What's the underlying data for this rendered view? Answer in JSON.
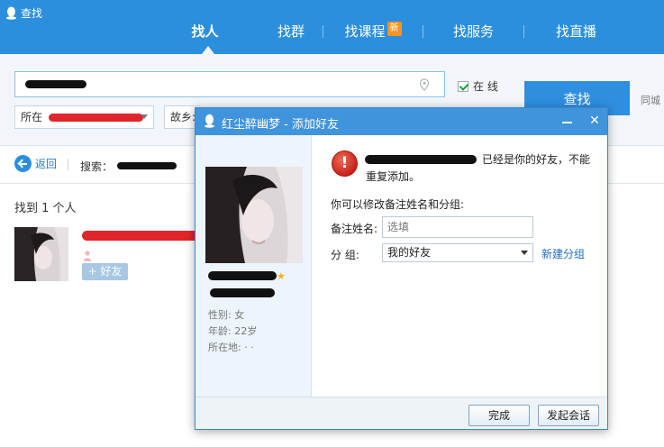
{
  "app": {
    "title": "查找"
  },
  "tabs": [
    {
      "label": "找人"
    },
    {
      "label": "找群"
    },
    {
      "label": "找课程"
    },
    {
      "label": "找服务"
    },
    {
      "label": "找直播"
    }
  ],
  "new_badge": "新",
  "search": {
    "online_label": "在  线",
    "button": "查找",
    "same_city": "同城",
    "filter_location": "所在",
    "filter_hometown": "故乡:"
  },
  "results": {
    "back": "返回",
    "search_label": "搜索：",
    "found": "找到 1 个人",
    "add_friend": "+ 好友"
  },
  "dialog": {
    "title": "红尘醉幽梦 - 添加好友",
    "message_line1": "已经是你的好友，不能",
    "message_line2": "重复添加。",
    "can_modify": "你可以修改备注姓名和分组:",
    "remark_label": "备注姓名:",
    "remark_placeholder": "选填",
    "group_label": "分      组:",
    "group_value": "我的好友",
    "new_group": "新建分组",
    "profile_gender": "性别: 女",
    "profile_age": "年龄: 22岁",
    "profile_location": "所在地: ·  ·",
    "btn_done": "完成",
    "btn_chat": "发起会话"
  },
  "colors": {
    "header": "#2b8fdd",
    "accent": "#2f8ee0",
    "link": "#1e6fbf"
  }
}
